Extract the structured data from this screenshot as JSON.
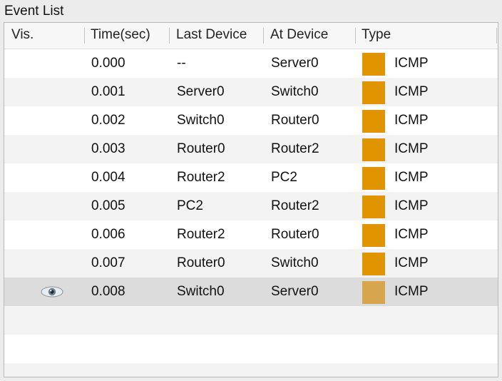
{
  "window": {
    "title": "Event List"
  },
  "columns": {
    "vis": "Vis.",
    "time": "Time(sec)",
    "last_device": "Last Device",
    "at_device": "At Device",
    "type": "Type"
  },
  "events": [
    {
      "time": "0.000",
      "last_device": "--",
      "at_device": "Server0",
      "type": "ICMP",
      "color": "#e09400",
      "visible_icon": false
    },
    {
      "time": "0.001",
      "last_device": "Server0",
      "at_device": "Switch0",
      "type": "ICMP",
      "color": "#e09400",
      "visible_icon": false
    },
    {
      "time": "0.002",
      "last_device": "Switch0",
      "at_device": "Router0",
      "type": "ICMP",
      "color": "#e09400",
      "visible_icon": false
    },
    {
      "time": "0.003",
      "last_device": "Router0",
      "at_device": "Router2",
      "type": "ICMP",
      "color": "#e09400",
      "visible_icon": false
    },
    {
      "time": "0.004",
      "last_device": "Router2",
      "at_device": "PC2",
      "type": "ICMP",
      "color": "#e09400",
      "visible_icon": false
    },
    {
      "time": "0.005",
      "last_device": "PC2",
      "at_device": "Router2",
      "type": "ICMP",
      "color": "#e09400",
      "visible_icon": false
    },
    {
      "time": "0.006",
      "last_device": "Router2",
      "at_device": "Router0",
      "type": "ICMP",
      "color": "#e09400",
      "visible_icon": false
    },
    {
      "time": "0.007",
      "last_device": "Router0",
      "at_device": "Switch0",
      "type": "ICMP",
      "color": "#e09400",
      "visible_icon": false
    },
    {
      "time": "0.008",
      "last_device": "Switch0",
      "at_device": "Server0",
      "type": "ICMP",
      "color": "#d6a54e",
      "visible_icon": true,
      "selected": true
    }
  ],
  "icons": {
    "visibility": "eye-icon"
  }
}
